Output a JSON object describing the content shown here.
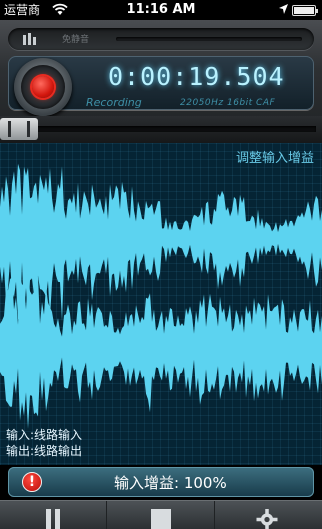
{
  "status_bar": {
    "carrier": "运营商",
    "time": "11:16 AM"
  },
  "mute": {
    "label": "免静音"
  },
  "recorder": {
    "timer": "0:00:19.504",
    "state_label": "Recording",
    "format_label": "22050Hz 16bit CAF"
  },
  "waveform": {
    "adjust_gain_link": "调整输入增益",
    "input_line": "输入:线路输入",
    "output_line": "输出:线路输出"
  },
  "gain_bar": {
    "warning_icon": "!",
    "text": "输入增益: 100%"
  },
  "colors": {
    "wave_fill": "#5cd3f0",
    "accent": "#68c9e6",
    "record_red": "#d3170e"
  },
  "icons": [
    "wifi-icon",
    "location-arrow-icon",
    "battery-icon",
    "mute-icon",
    "record-icon",
    "warning-icon",
    "pause-icon",
    "stop-icon",
    "gear-icon"
  ]
}
